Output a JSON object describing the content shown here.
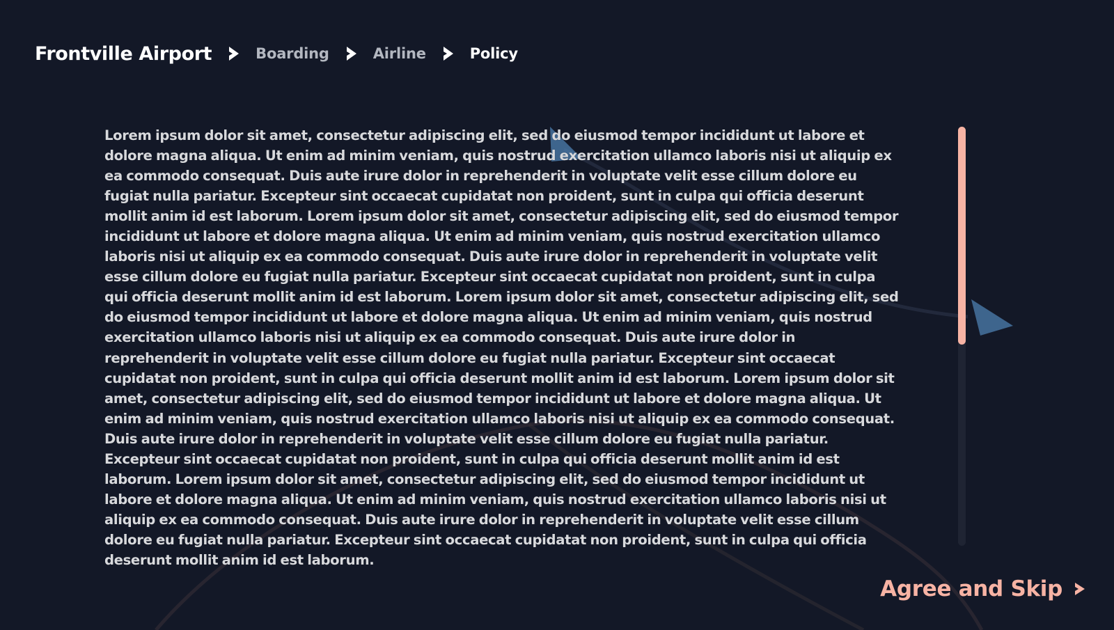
{
  "breadcrumb": {
    "root": "Frontville Airport",
    "items": [
      "Boarding",
      "Airline"
    ],
    "current": "Policy",
    "separator_icon": "chevron-right-icon"
  },
  "policy": {
    "text": "Lorem ipsum dolor sit amet, consectetur adipiscing elit, sed do eiusmod tempor incididunt ut labore et dolore magna aliqua. Ut enim ad minim veniam, quis nostrud exercitation ullamco laboris nisi ut aliquip ex ea commodo consequat. Duis aute irure dolor in reprehenderit in voluptate velit esse cillum dolore eu fugiat nulla pariatur. Excepteur sint occaecat cupidatat non proident, sunt in culpa qui officia deserunt mollit anim id est laborum. Lorem ipsum dolor sit amet, consectetur adipiscing elit, sed do eiusmod tempor incididunt ut labore et dolore magna aliqua. Ut enim ad minim veniam, quis nostrud exercitation ullamco laboris nisi ut aliquip ex ea commodo consequat. Duis aute irure dolor in reprehenderit in voluptate velit esse cillum dolore eu fugiat nulla pariatur. Excepteur sint occaecat cupidatat non proident, sunt in culpa qui officia deserunt mollit anim id est laborum. Lorem ipsum dolor sit amet, consectetur adipiscing elit, sed do eiusmod tempor incididunt ut labore et dolore magna aliqua. Ut enim ad minim veniam, quis nostrud exercitation ullamco laboris nisi ut aliquip ex ea commodo consequat. Duis aute irure dolor in reprehenderit in voluptate velit esse cillum dolore eu fugiat nulla pariatur. Excepteur sint occaecat cupidatat non proident, sunt in culpa qui officia deserunt mollit anim id est laborum. Lorem ipsum dolor sit amet, consectetur adipiscing elit, sed do eiusmod tempor incididunt ut labore et dolore magna aliqua. Ut enim ad minim veniam, quis nostrud exercitation ullamco laboris nisi ut aliquip ex ea commodo consequat. Duis aute irure dolor in reprehenderit in voluptate velit esse cillum dolore eu fugiat nulla pariatur. Excepteur sint occaecat cupidatat non proident, sunt in culpa qui officia deserunt mollit anim id est laborum. Lorem ipsum dolor sit amet, consectetur adipiscing elit, sed do eiusmod tempor incididunt ut labore et dolore magna aliqua. Ut enim ad minim veniam, quis nostrud exercitation ullamco laboris nisi ut aliquip ex ea commodo consequat. Duis aute irure dolor in reprehenderit in voluptate velit esse cillum dolore eu fugiat nulla pariatur. Excepteur sint occaecat cupidatat non proident, sunt in culpa qui officia deserunt mollit anim id est laborum.",
    "scroll_fraction_visible": 0.52
  },
  "agree_button": {
    "label": "Agree and Skip",
    "icon": "chevron-right-icon"
  },
  "colors": {
    "background": "#131827",
    "accent": "#f7b3a4",
    "text": "#d8d9dc",
    "muted": "#b3b7c0",
    "decor_blue": "#4d7fb0"
  }
}
